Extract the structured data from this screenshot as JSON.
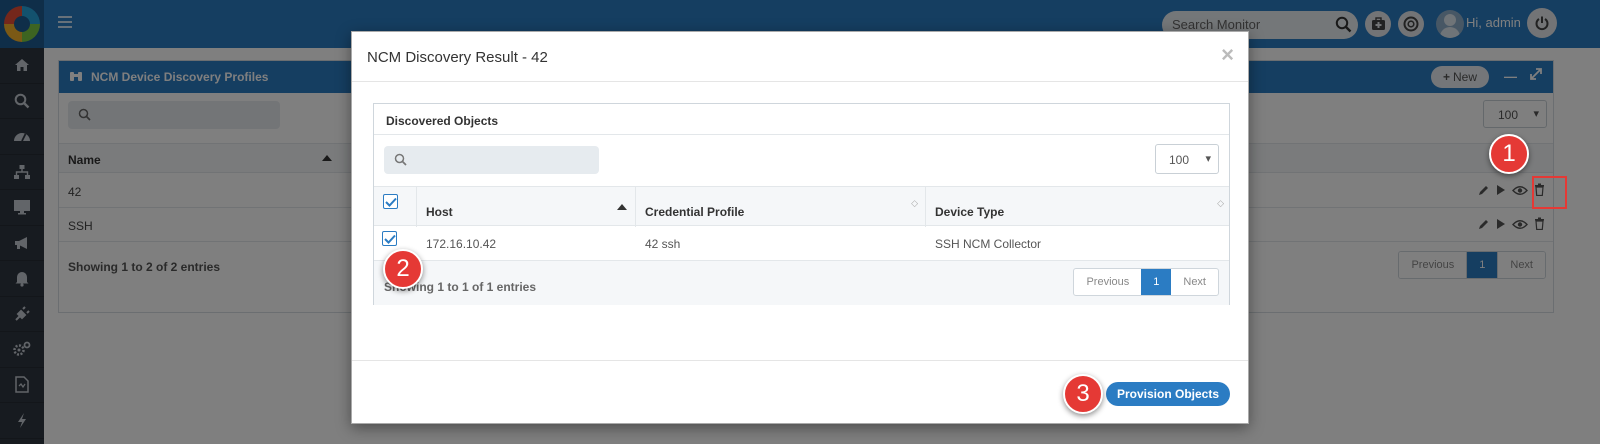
{
  "topbar": {
    "search_placeholder": "Search Monitor",
    "greeting": "Hi, admin"
  },
  "sidebar": {
    "items": [
      "home-icon",
      "search-icon",
      "dashboard-icon",
      "topology-icon",
      "monitor-icon",
      "megaphone-icon",
      "bell-icon",
      "plug-icon",
      "settings-icon",
      "report-icon",
      "flash-icon"
    ]
  },
  "background_panel": {
    "title": "NCM Device Discovery Profiles",
    "new_label": "New",
    "page_size": "100",
    "column_name": "Name",
    "rows": [
      "42",
      "SSH"
    ],
    "info": "Showing 1 to 2 of 2 entries",
    "pager": {
      "previous": "Previous",
      "current": "1",
      "next": "Next"
    }
  },
  "modal": {
    "title": "NCM Discovery Result - 42",
    "close": "×",
    "section_title": "Discovered Objects",
    "page_size": "100",
    "columns": {
      "host": "Host",
      "credential_profile": "Credential Profile",
      "device_type": "Device Type"
    },
    "rows": [
      {
        "host": "172.16.10.42",
        "credential_profile": "42 ssh",
        "device_type": "SSH NCM Collector"
      }
    ],
    "info": "Showing 1 to 1 of 1 entries",
    "pager": {
      "previous": "Previous",
      "current": "1",
      "next": "Next"
    },
    "provision_label": "Provision Objects"
  },
  "callouts": {
    "one": "1",
    "two": "2",
    "three": "3"
  },
  "colors": {
    "primary": "#2b7cc3",
    "callout": "#e53935",
    "sidebar": "#2f3640"
  }
}
